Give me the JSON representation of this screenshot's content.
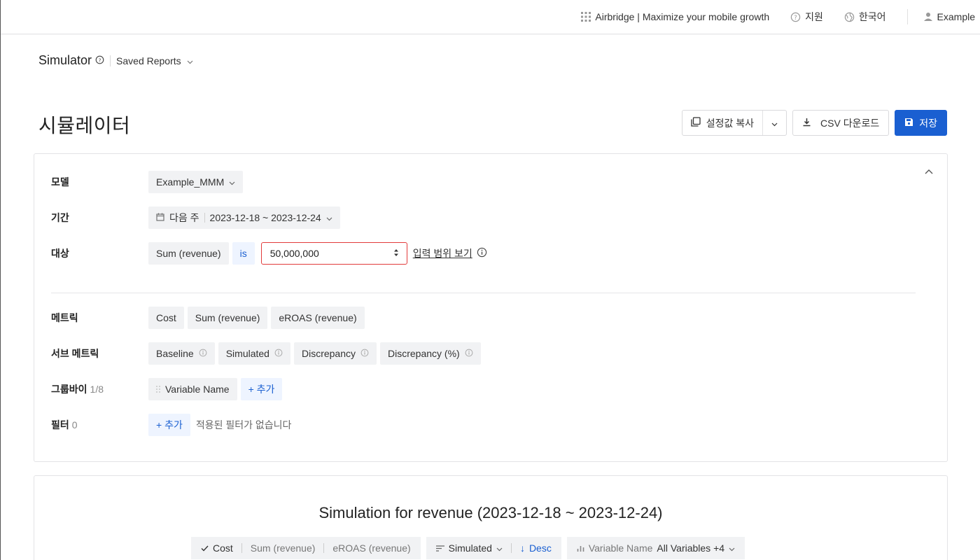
{
  "topbar": {
    "app_name": "Airbridge | Maximize your mobile growth",
    "support": "지원",
    "language": "한국어",
    "user": "Example"
  },
  "header": {
    "breadcrumb_title": "Simulator",
    "saved_reports": "Saved Reports",
    "page_title": "시뮬레이터",
    "copy_settings": "설정값 복사",
    "csv_download": "CSV 다운로드",
    "save": "저장"
  },
  "config": {
    "model_label": "모델",
    "model_value": "Example_MMM",
    "period_label": "기간",
    "period_preset": "다음 주",
    "period_range": "2023-12-18 ~ 2023-12-24",
    "target_label": "대상",
    "target_metric": "Sum (revenue)",
    "target_op": "is",
    "target_value": "50,000,000",
    "view_range_link": "입력 범위 보기",
    "metrics_label": "메트릭",
    "metrics": [
      "Cost",
      "Sum (revenue)",
      "eROAS (revenue)"
    ],
    "submetrics_label": "서브 메트릭",
    "submetrics": [
      "Baseline",
      "Simulated",
      "Discrepancy",
      "Discrepancy (%)"
    ],
    "groupby_label": "그룹바이",
    "groupby_count": "1/8",
    "groupby_item": "Variable Name",
    "add_label": "+ 추가",
    "filter_label": "필터",
    "filter_count": "0",
    "no_filter_text": "적용된 필터가 없습니다"
  },
  "simulation": {
    "title": "Simulation for revenue (2023-12-18 ~ 2023-12-24)",
    "metric_selected": "Cost",
    "metric_other1": "Sum (revenue)",
    "metric_other2": "eROAS (revenue)",
    "sort_by": "Simulated",
    "sort_dir": "Desc",
    "dimension": "Variable Name",
    "dimension_value": "All Variables +4"
  },
  "colors": {
    "primary": "#1a5fd1",
    "error_border": "#e23b3b"
  }
}
